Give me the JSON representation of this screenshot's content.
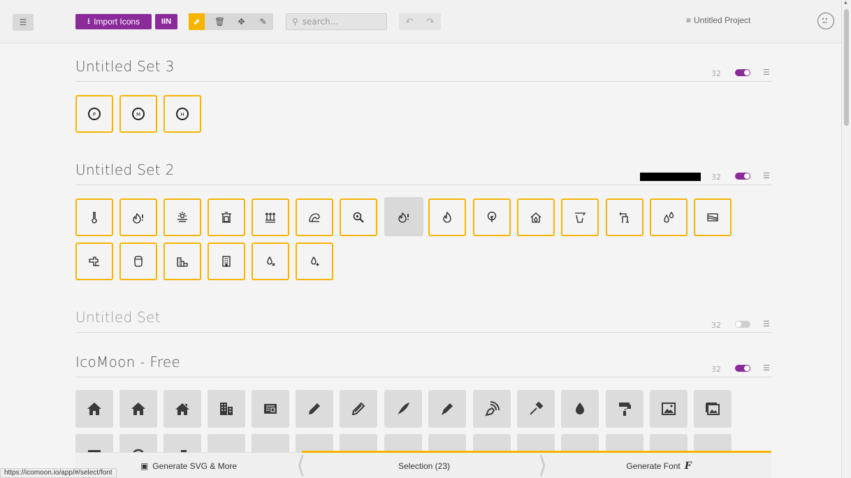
{
  "toolbar": {
    "import_label": "Import Icons",
    "library_label": "IIN",
    "search_placeholder": "search...",
    "project_label": "Untitled Project"
  },
  "sets": [
    {
      "title": "Untitled Set 3",
      "count": "32",
      "enabled": true
    },
    {
      "title": "Untitled Set 2",
      "count": "32",
      "enabled": true
    },
    {
      "title": "Untitled Set",
      "count": "32",
      "enabled": false
    },
    {
      "title": "IcoMoon - Free",
      "count": "32",
      "enabled": true
    }
  ],
  "set3_icons": [
    "P",
    "M",
    "H"
  ],
  "set2_icon_names": [
    "thermometer-icon",
    "flame-alert-icon",
    "sunset-icon",
    "well-icon",
    "field-icon",
    "wave-icon",
    "search-zoom-icon",
    "flame-alert-icon",
    "flame-icon",
    "tree-icon",
    "house-drop-icon",
    "bucket-icon",
    "pipe-icon",
    "drops-icon",
    "flag-icon",
    "faucet-icon",
    "cylinder-icon",
    "factory-icon",
    "building-icon",
    "drop-x-icon",
    "drop-plus-icon"
  ],
  "free_icon_names": [
    "home-icon",
    "home2-icon",
    "home3-icon",
    "office-icon",
    "newspaper-icon",
    "pencil-icon",
    "pencil2-icon",
    "quill-icon",
    "pen-icon",
    "blog-icon",
    "eyedropper-icon",
    "droplet-icon",
    "paint-format-icon",
    "image-icon",
    "images-icon"
  ],
  "bottom": {
    "generate_svg": "Generate SVG & More",
    "selection": "Selection (23)",
    "generate_font": "Generate Font"
  },
  "status_url": "https://icomoon.io/app/#/select/font",
  "colors": {
    "accent": "#8b2b9a",
    "selection": "#f6b500"
  }
}
